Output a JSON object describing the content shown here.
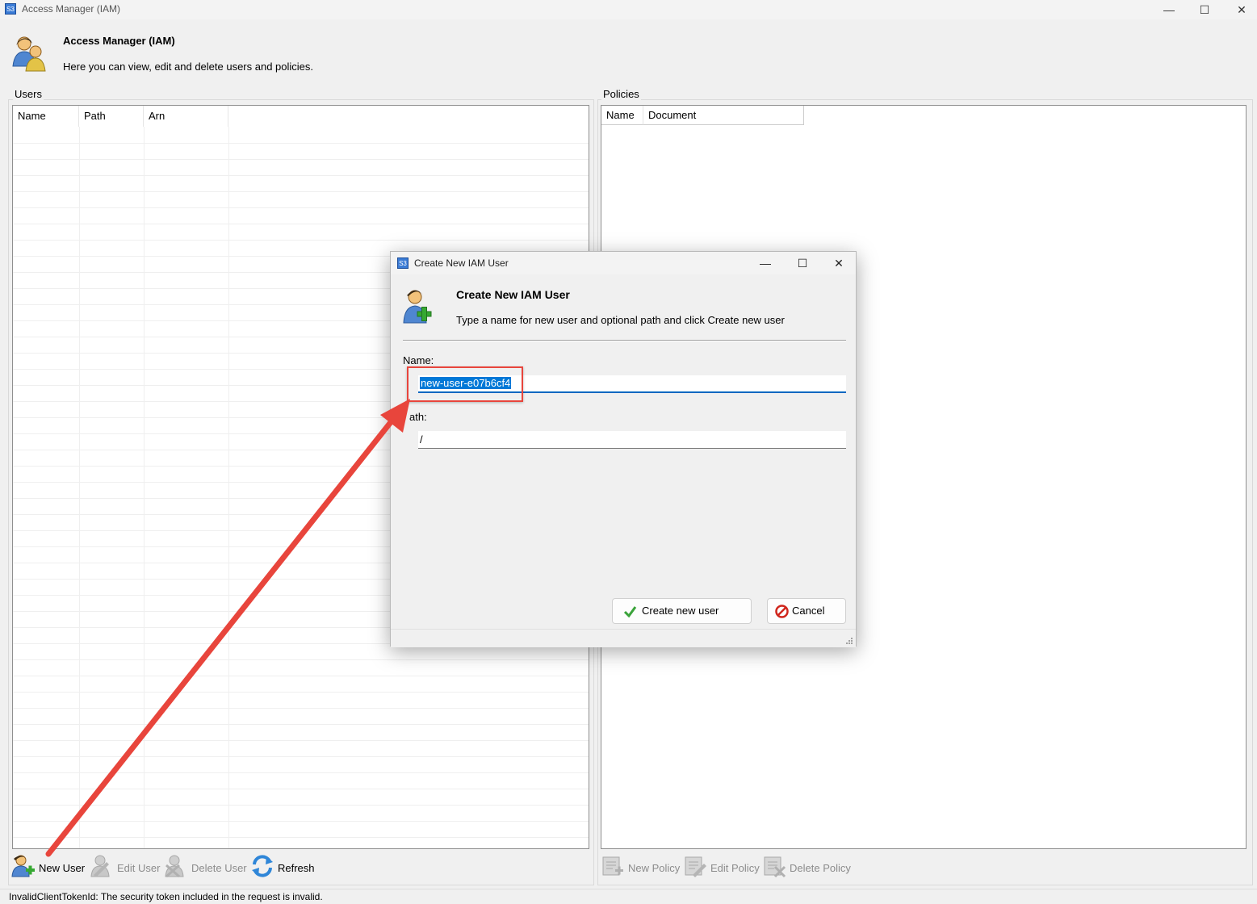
{
  "window": {
    "title": "Access Manager (IAM)",
    "app_icon_text": "S3",
    "min": "—",
    "max": "☐",
    "close": "✕"
  },
  "header": {
    "title": "Access Manager (IAM)",
    "description": "Here you can view, edit and delete users and policies."
  },
  "users": {
    "group_label": "Users",
    "columns": [
      "Name",
      "Path",
      "Arn"
    ],
    "toolbar": {
      "new": "New User",
      "edit": "Edit User",
      "delete": "Delete User",
      "refresh": "Refresh"
    }
  },
  "policies": {
    "group_label": "Policies",
    "columns": [
      "Name",
      "Document"
    ],
    "toolbar": {
      "new": "New Policy",
      "edit": "Edit Policy",
      "delete": "Delete Policy"
    }
  },
  "status": {
    "text": "InvalidClientTokenId: The security token included in the request is invalid."
  },
  "dialog": {
    "title": "Create New IAM User",
    "app_icon_text": "S3",
    "min": "—",
    "max": "☐",
    "close": "✕",
    "heading": "Create New IAM User",
    "description": "Type a name for new user and optional path and click Create new user",
    "name_label": "Name:",
    "name_value": "new-user-e07b6cf4",
    "path_label": "ath:",
    "path_value": "/",
    "create_button": "Create new user",
    "cancel_button": "Cancel"
  },
  "colors": {
    "accent": "#0078d7",
    "annotation": "#e8453c"
  },
  "icons": [
    "users-icon",
    "add-user-icon",
    "edit-user-icon",
    "delete-user-icon",
    "refresh-icon",
    "new-policy-icon",
    "edit-policy-icon",
    "delete-policy-icon",
    "check-icon",
    "cancel-icon"
  ]
}
